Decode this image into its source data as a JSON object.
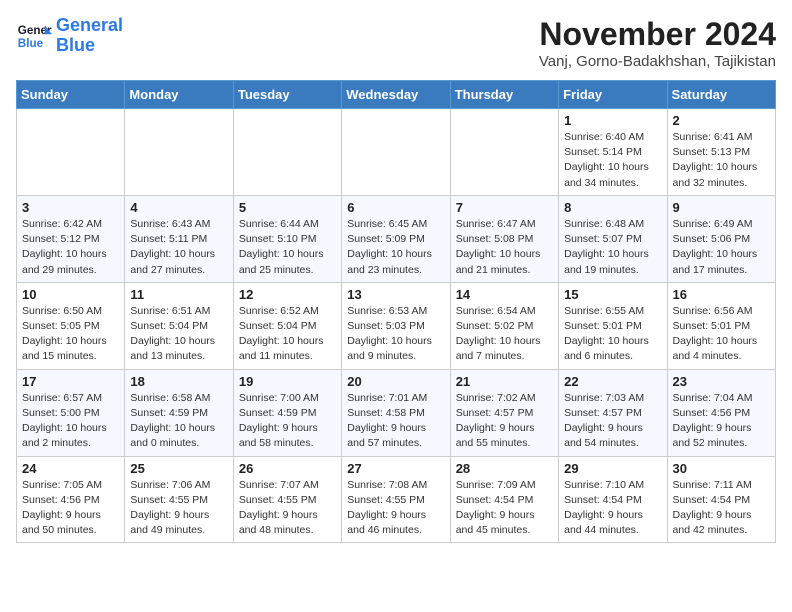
{
  "logo": {
    "line1": "General",
    "line2": "Blue"
  },
  "title": "November 2024",
  "location": "Vanj, Gorno-Badakhshan, Tajikistan",
  "days_of_week": [
    "Sunday",
    "Monday",
    "Tuesday",
    "Wednesday",
    "Thursday",
    "Friday",
    "Saturday"
  ],
  "weeks": [
    [
      {
        "day": "",
        "info": ""
      },
      {
        "day": "",
        "info": ""
      },
      {
        "day": "",
        "info": ""
      },
      {
        "day": "",
        "info": ""
      },
      {
        "day": "",
        "info": ""
      },
      {
        "day": "1",
        "info": "Sunrise: 6:40 AM\nSunset: 5:14 PM\nDaylight: 10 hours\nand 34 minutes."
      },
      {
        "day": "2",
        "info": "Sunrise: 6:41 AM\nSunset: 5:13 PM\nDaylight: 10 hours\nand 32 minutes."
      }
    ],
    [
      {
        "day": "3",
        "info": "Sunrise: 6:42 AM\nSunset: 5:12 PM\nDaylight: 10 hours\nand 29 minutes."
      },
      {
        "day": "4",
        "info": "Sunrise: 6:43 AM\nSunset: 5:11 PM\nDaylight: 10 hours\nand 27 minutes."
      },
      {
        "day": "5",
        "info": "Sunrise: 6:44 AM\nSunset: 5:10 PM\nDaylight: 10 hours\nand 25 minutes."
      },
      {
        "day": "6",
        "info": "Sunrise: 6:45 AM\nSunset: 5:09 PM\nDaylight: 10 hours\nand 23 minutes."
      },
      {
        "day": "7",
        "info": "Sunrise: 6:47 AM\nSunset: 5:08 PM\nDaylight: 10 hours\nand 21 minutes."
      },
      {
        "day": "8",
        "info": "Sunrise: 6:48 AM\nSunset: 5:07 PM\nDaylight: 10 hours\nand 19 minutes."
      },
      {
        "day": "9",
        "info": "Sunrise: 6:49 AM\nSunset: 5:06 PM\nDaylight: 10 hours\nand 17 minutes."
      }
    ],
    [
      {
        "day": "10",
        "info": "Sunrise: 6:50 AM\nSunset: 5:05 PM\nDaylight: 10 hours\nand 15 minutes."
      },
      {
        "day": "11",
        "info": "Sunrise: 6:51 AM\nSunset: 5:04 PM\nDaylight: 10 hours\nand 13 minutes."
      },
      {
        "day": "12",
        "info": "Sunrise: 6:52 AM\nSunset: 5:04 PM\nDaylight: 10 hours\nand 11 minutes."
      },
      {
        "day": "13",
        "info": "Sunrise: 6:53 AM\nSunset: 5:03 PM\nDaylight: 10 hours\nand 9 minutes."
      },
      {
        "day": "14",
        "info": "Sunrise: 6:54 AM\nSunset: 5:02 PM\nDaylight: 10 hours\nand 7 minutes."
      },
      {
        "day": "15",
        "info": "Sunrise: 6:55 AM\nSunset: 5:01 PM\nDaylight: 10 hours\nand 6 minutes."
      },
      {
        "day": "16",
        "info": "Sunrise: 6:56 AM\nSunset: 5:01 PM\nDaylight: 10 hours\nand 4 minutes."
      }
    ],
    [
      {
        "day": "17",
        "info": "Sunrise: 6:57 AM\nSunset: 5:00 PM\nDaylight: 10 hours\nand 2 minutes."
      },
      {
        "day": "18",
        "info": "Sunrise: 6:58 AM\nSunset: 4:59 PM\nDaylight: 10 hours\nand 0 minutes."
      },
      {
        "day": "19",
        "info": "Sunrise: 7:00 AM\nSunset: 4:59 PM\nDaylight: 9 hours\nand 58 minutes."
      },
      {
        "day": "20",
        "info": "Sunrise: 7:01 AM\nSunset: 4:58 PM\nDaylight: 9 hours\nand 57 minutes."
      },
      {
        "day": "21",
        "info": "Sunrise: 7:02 AM\nSunset: 4:57 PM\nDaylight: 9 hours\nand 55 minutes."
      },
      {
        "day": "22",
        "info": "Sunrise: 7:03 AM\nSunset: 4:57 PM\nDaylight: 9 hours\nand 54 minutes."
      },
      {
        "day": "23",
        "info": "Sunrise: 7:04 AM\nSunset: 4:56 PM\nDaylight: 9 hours\nand 52 minutes."
      }
    ],
    [
      {
        "day": "24",
        "info": "Sunrise: 7:05 AM\nSunset: 4:56 PM\nDaylight: 9 hours\nand 50 minutes."
      },
      {
        "day": "25",
        "info": "Sunrise: 7:06 AM\nSunset: 4:55 PM\nDaylight: 9 hours\nand 49 minutes."
      },
      {
        "day": "26",
        "info": "Sunrise: 7:07 AM\nSunset: 4:55 PM\nDaylight: 9 hours\nand 48 minutes."
      },
      {
        "day": "27",
        "info": "Sunrise: 7:08 AM\nSunset: 4:55 PM\nDaylight: 9 hours\nand 46 minutes."
      },
      {
        "day": "28",
        "info": "Sunrise: 7:09 AM\nSunset: 4:54 PM\nDaylight: 9 hours\nand 45 minutes."
      },
      {
        "day": "29",
        "info": "Sunrise: 7:10 AM\nSunset: 4:54 PM\nDaylight: 9 hours\nand 44 minutes."
      },
      {
        "day": "30",
        "info": "Sunrise: 7:11 AM\nSunset: 4:54 PM\nDaylight: 9 hours\nand 42 minutes."
      }
    ]
  ]
}
